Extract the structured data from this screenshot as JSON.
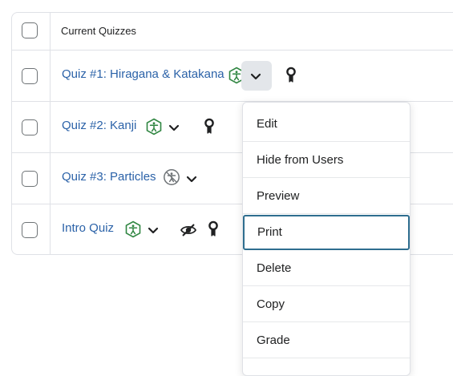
{
  "table": {
    "header_label": "Current Quizzes",
    "rows": [
      {
        "title": "Quiz #1: Hiragana & Katakana",
        "accessibility_status": "enabled",
        "menu_open": true
      },
      {
        "title": "Quiz #2: Kanji",
        "accessibility_status": "enabled"
      },
      {
        "title": "Quiz #3: Particles",
        "accessibility_status": "disabled"
      },
      {
        "title": "Intro Quiz",
        "accessibility_status": "enabled",
        "hidden_from_users": true
      }
    ]
  },
  "context_menu": {
    "items": [
      "Edit",
      "Hide from Users",
      "Preview",
      "Print",
      "Delete",
      "Copy",
      "Grade"
    ],
    "focused_item": "Print"
  },
  "icons": {
    "accessibility": "accessibility-icon",
    "chevron": "chevron-down-icon",
    "release_conditions": "award-ribbon-icon",
    "hidden": "eye-slash-icon"
  },
  "colors": {
    "link": "#2b62a8",
    "accessibility_enabled": "#2e8540",
    "accessibility_disabled": "#6e7376",
    "focus_border": "#2f6e8f"
  }
}
